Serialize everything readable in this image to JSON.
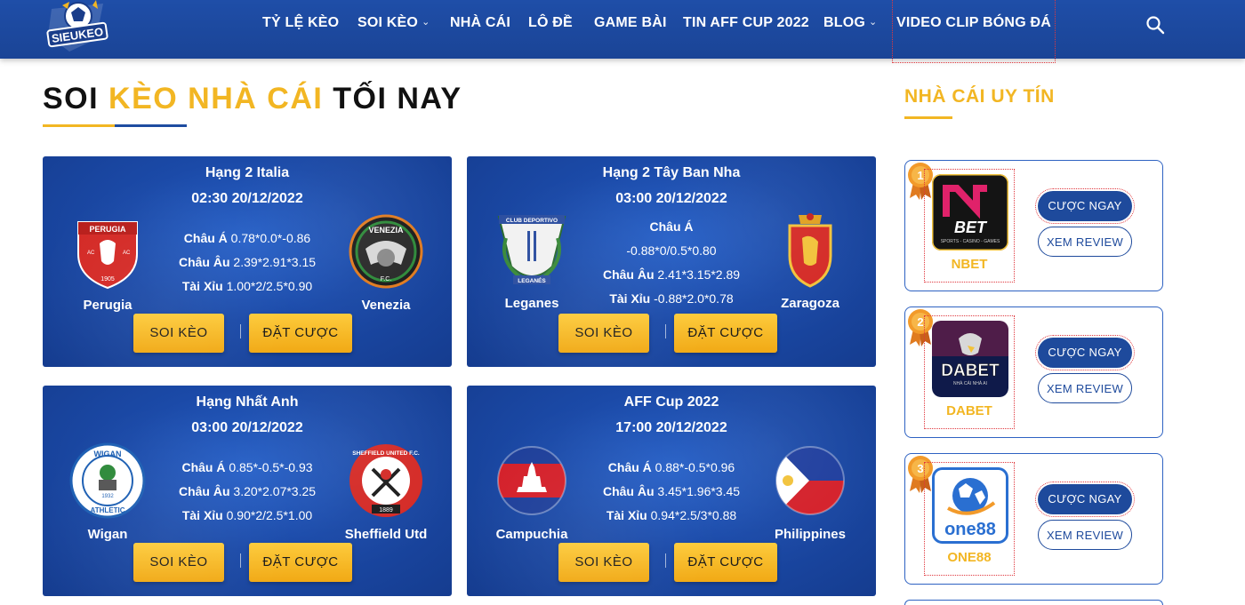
{
  "header": {
    "logo_text": "SIEUKEO",
    "nav": [
      {
        "label": "TỶ LỆ KÈO",
        "dropdown": false
      },
      {
        "label": "SOI KÈO",
        "dropdown": true
      },
      {
        "label": "NHÀ CÁI",
        "dropdown": false
      },
      {
        "label": "LÔ ĐỀ",
        "dropdown": false
      },
      {
        "label": "GAME BÀI",
        "dropdown": false
      },
      {
        "label": "TIN AFF CUP 2022",
        "dropdown": false
      },
      {
        "label": "BLOG",
        "dropdown": true
      },
      {
        "label": "VIDEO CLIP BÓNG ĐÁ",
        "dropdown": false
      }
    ],
    "search_icon": "search-icon"
  },
  "page_title": {
    "part1": "SOI ",
    "accent": "KÈO NHÀ CÁI",
    "part2": " TỐI NAY"
  },
  "matches": [
    {
      "league": "Hạng 2 Italia",
      "time": "02:30 20/12/2022",
      "home": "Perugia",
      "away": "Venezia",
      "odds": [
        {
          "label": "Châu Á",
          "value": "0.78*0.0*-0.86"
        },
        {
          "label": "Châu Âu",
          "value": "2.39*2.91*3.15"
        },
        {
          "label": "Tài Xỉu",
          "value": "1.00*2/2.5*0.90"
        }
      ],
      "btn_soi": "SOI KÈO",
      "btn_dat": "ĐẶT CƯỢC"
    },
    {
      "league": "Hạng 2 Tây Ban Nha",
      "time": "03:00 20/12/2022",
      "home": "Leganes",
      "away": "Zaragoza",
      "odds_head": "Châu Á",
      "odds_head_value": "-0.88*0/0.5*0.80",
      "odds": [
        {
          "label": "Châu Âu",
          "value": "2.41*3.15*2.89"
        },
        {
          "label": "Tài Xỉu",
          "value": "-0.88*2.0*0.78"
        }
      ],
      "btn_soi": "SOI KÈO",
      "btn_dat": "ĐẶT CƯỢC"
    },
    {
      "league": "Hạng Nhất Anh",
      "time": "03:00 20/12/2022",
      "home": "Wigan",
      "away": "Sheffield Utd",
      "odds": [
        {
          "label": "Châu Á",
          "value": "0.85*-0.5*-0.93"
        },
        {
          "label": "Châu Âu",
          "value": "3.20*2.07*3.25"
        },
        {
          "label": "Tài Xỉu",
          "value": "0.90*2/2.5*1.00"
        }
      ],
      "btn_soi": "SOI KÈO",
      "btn_dat": "ĐẶT CƯỢC"
    },
    {
      "league": "AFF Cup 2022",
      "time": "17:00 20/12/2022",
      "home": "Campuchia",
      "away": "Philippines",
      "odds": [
        {
          "label": "Châu Á",
          "value": "0.88*-0.5*0.96"
        },
        {
          "label": "Châu Âu",
          "value": "3.45*1.96*3.45"
        },
        {
          "label": "Tài Xỉu",
          "value": "0.94*2.5/3*0.88"
        }
      ],
      "btn_soi": "SOI KÈO",
      "btn_dat": "ĐẶT CƯỢC"
    }
  ],
  "crest_text": {
    "perugia": "PERUGIA",
    "perugia_year": "1905",
    "perugia_ac": "AC",
    "venezia": "VENEZIA",
    "venezia_fc": "F.C.",
    "leganes_top": "CLUB DEPORTIVO",
    "leganes_bottom": "LEGANÉS",
    "wigan_top": "WIGAN",
    "wigan_bottom": "ATHLETIC",
    "wigan_year": "1932",
    "sheffield": "SHEFFIELD UNITED F.C.",
    "sheffield_year": "1889"
  },
  "sidebar": {
    "title": "NHÀ CÁI UY TÍN",
    "bookies": [
      {
        "rank": "1",
        "name": "NBET",
        "logo_text": "BET",
        "logo_sub": "SPORTS - CASINO - GAMES",
        "cta": "CƯỢC NGAY",
        "review": "XEM REVIEW"
      },
      {
        "rank": "2",
        "name": "DABET",
        "logo_text": "DABET",
        "logo_sub": "NHÀ CÁI NHÀ AI",
        "cta": "CƯỢC NGAY",
        "review": "XEM REVIEW"
      },
      {
        "rank": "3",
        "name": "ONE88",
        "logo_text": "one88",
        "cta": "CƯỢC NGAY",
        "review": "XEM REVIEW"
      }
    ]
  },
  "colors": {
    "header_blue": "#1f4ea8",
    "accent_yellow": "#f2b623",
    "card_blue": "#1b4aa8",
    "button_yellow": "#fdcb3b"
  }
}
